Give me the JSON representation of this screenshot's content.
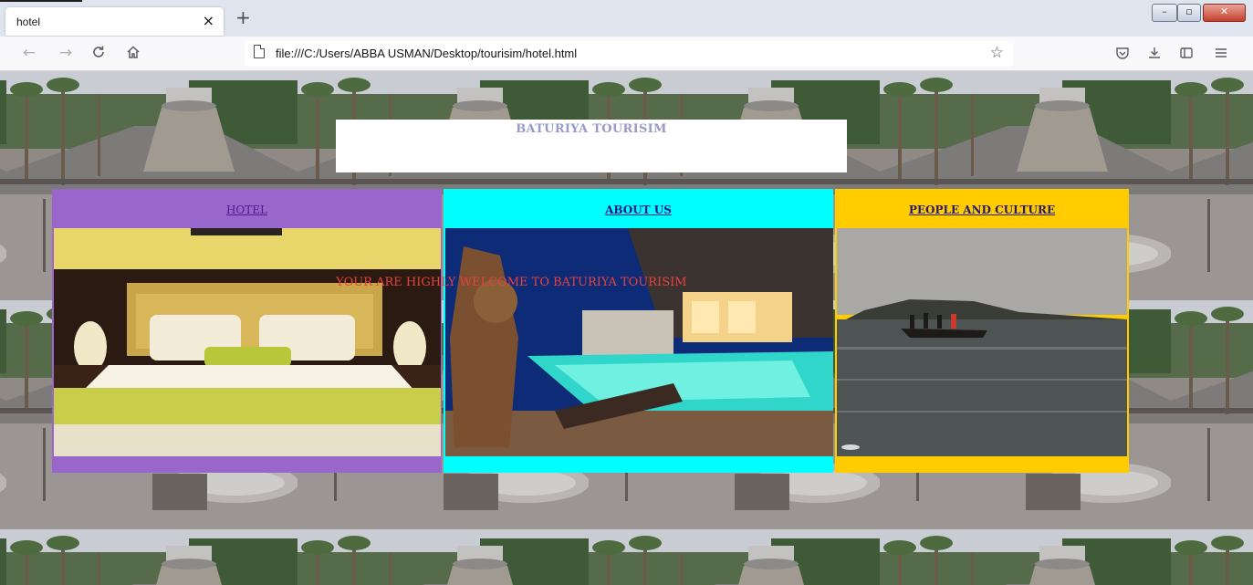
{
  "browser": {
    "tab_title": "hotel",
    "tab_close": "×",
    "new_tab": "+",
    "url": "file:///C:/Users/ABBA USMAN/Desktop/tourisim/hotel.html",
    "window_controls": {
      "minimize": "–",
      "maximize": "▫",
      "close": "✕"
    },
    "nav_icons": [
      "back-arrow-icon",
      "forward-arrow-icon",
      "reload-icon",
      "home-icon"
    ],
    "toolbar_icons": [
      "pocket-icon",
      "download-icon",
      "sidebar-icon",
      "menu-icon"
    ]
  },
  "page": {
    "site_title": "BATURIYA TOURISIM",
    "welcome_text": "YOUR ARE HIGHLY WELCOME TO BATURIYA TOURISIM",
    "columns": [
      {
        "label": "HOTEL",
        "color": "#9966cc",
        "image": "hotel-bedroom-photo"
      },
      {
        "label": "ABOUT US",
        "color": "#00ffff",
        "image": "hotel-pool-photo"
      },
      {
        "label": "PEOPLE AND CULTURE",
        "color": "#ffcc00",
        "image": "canoe-lake-photo"
      }
    ],
    "welcome_color": "#e8413d",
    "title_color": "#9999cc"
  }
}
